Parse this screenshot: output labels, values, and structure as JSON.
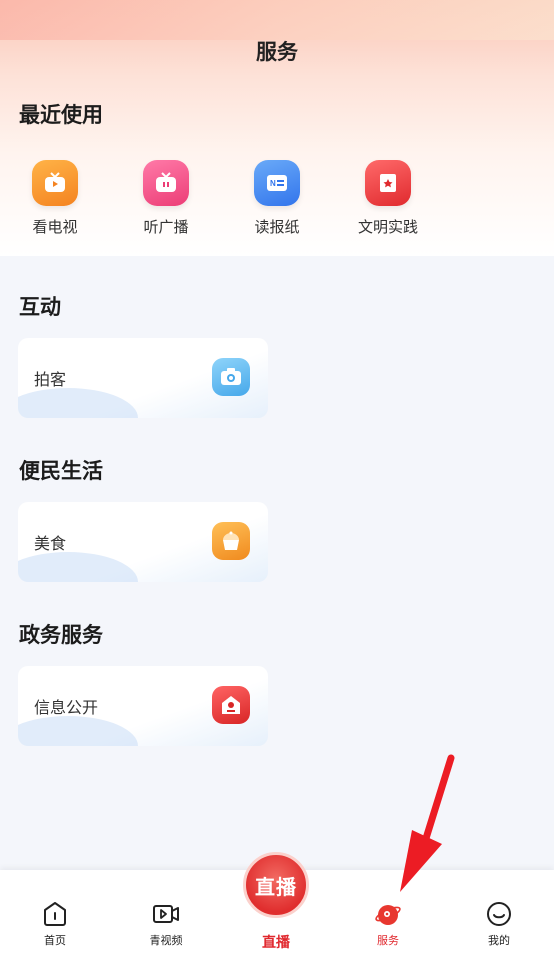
{
  "header": {
    "title": "服务"
  },
  "recent": {
    "title": "最近使用",
    "items": [
      {
        "label": "看电视",
        "icon": "tv-icon",
        "color": "#f7902c"
      },
      {
        "label": "听广播",
        "icon": "radio-icon",
        "color": "#f24f85"
      },
      {
        "label": "读报纸",
        "icon": "newspaper-icon",
        "color": "#3f84f2"
      },
      {
        "label": "文明实践",
        "icon": "book-icon",
        "color": "#ec3a3d"
      }
    ]
  },
  "sections": [
    {
      "title": "互动",
      "card": {
        "label": "拍客",
        "icon": "camera-icon",
        "color": "#59b8f0"
      }
    },
    {
      "title": "便民生活",
      "card": {
        "label": "美食",
        "icon": "cake-icon",
        "color": "#f5a030"
      }
    },
    {
      "title": "政务服务",
      "card": {
        "label": "信息公开",
        "icon": "government-house-icon",
        "color": "#e83a3a"
      }
    }
  ],
  "tabbar": {
    "items": [
      {
        "label": "首页",
        "icon": "home-icon"
      },
      {
        "label": "青视频",
        "icon": "video-icon"
      },
      {
        "label": "服务",
        "icon": "service-planet-icon",
        "active": true
      },
      {
        "label": "我的",
        "icon": "smile-icon"
      }
    ],
    "live": {
      "label": "直播",
      "badge": "直播"
    }
  },
  "colors": {
    "accent": "#e0272d"
  }
}
